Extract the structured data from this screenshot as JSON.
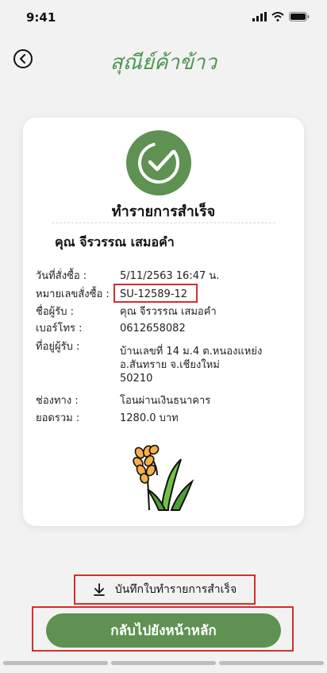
{
  "status_bar": {
    "time": "9:41",
    "signal_icon": "signal-bars-icon",
    "wifi_icon": "wifi-icon",
    "battery_icon": "battery-icon"
  },
  "header": {
    "title": "สุณีย์ค้าข้าว",
    "back_icon": "chevron-left-icon"
  },
  "card": {
    "success_icon": "check-circle-icon",
    "success_title": "ทำรายการสำเร็จ",
    "customer_name": "คุณ จีรวรรณ เสมอคำ",
    "order_date_label": "วันที่สั่งซื้อ :",
    "order_date_value": "5/11/2563 16:47 น.",
    "order_number_label": "หมายเลขสั่งซื้อ :",
    "order_number_value": "SU-12589-12",
    "recipient_label": "ชื่อผู้รับ :",
    "recipient_value": "คุณ จีรวรรณ เสมอคำ",
    "phone_label": "เบอร์โทร :",
    "phone_value": "0612658082",
    "address_label": "ที่อยู่ผู้รับ :",
    "address_lines": [
      "บ้านเลขที่ 14 ม.4 ต.หนองแหย่ง",
      "อ.สันทราย จ.เชียงใหม่",
      "50210"
    ],
    "channel_label": "ช่องทาง :",
    "channel_value": "โอนผ่านเงินธนาคาร",
    "total_label": "ยอดรวม :",
    "total_value": "1280.0 บาท",
    "illustration_icon": "rice-plant-icon"
  },
  "actions": {
    "save_receipt_label": "บันทึกใบทำรายการสำเร็จ",
    "save_icon": "download-icon",
    "home_button_label": "กลับไปยังหน้าหลัก"
  },
  "colors": {
    "brand_green": "#5e9152",
    "title_green": "#4e9650",
    "highlight_red": "#d62e2e"
  }
}
